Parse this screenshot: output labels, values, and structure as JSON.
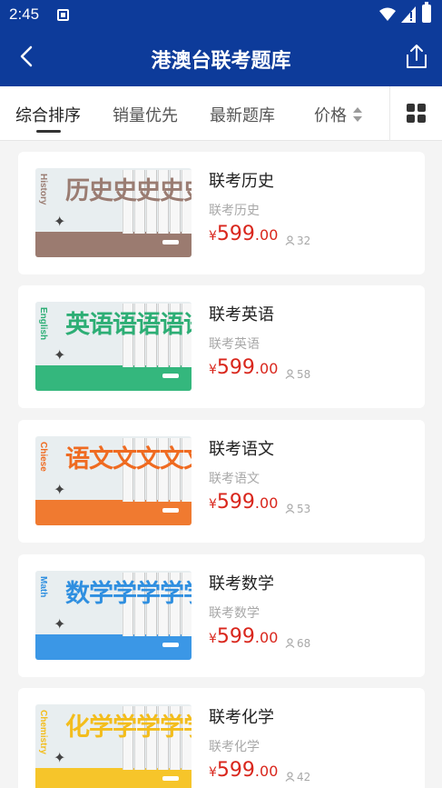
{
  "status_bar": {
    "time": "2:45"
  },
  "header": {
    "title": "港澳台联考题库"
  },
  "sort_tabs": [
    {
      "label": "综合排序",
      "active": true
    },
    {
      "label": "销量优先",
      "active": false
    },
    {
      "label": "最新题库",
      "active": false
    },
    {
      "label": "价格",
      "active": false
    }
  ],
  "products": [
    {
      "name": "联考历史",
      "subtitle": "联考历史",
      "currency": "¥",
      "price_int": "599",
      "price_dec": ".00",
      "buyers": "32",
      "cover_en": "History",
      "cover_cn": "历史",
      "cover_repeat": "史",
      "color": "#9a7c72",
      "band": "#9b7b70"
    },
    {
      "name": "联考英语",
      "subtitle": "联考英语",
      "currency": "¥",
      "price_int": "599",
      "price_dec": ".00",
      "buyers": "58",
      "cover_en": "English",
      "cover_cn": "英语",
      "cover_repeat": "语",
      "color": "#2dae75",
      "band": "#34b77d"
    },
    {
      "name": "联考语文",
      "subtitle": "联考语文",
      "currency": "¥",
      "price_int": "599",
      "price_dec": ".00",
      "buyers": "53",
      "cover_en": "Chiese",
      "cover_cn": "语文",
      "cover_repeat": "文",
      "color": "#ef6b21",
      "band": "#f07a30"
    },
    {
      "name": "联考数学",
      "subtitle": "联考数学",
      "currency": "¥",
      "price_int": "599",
      "price_dec": ".00",
      "buyers": "68",
      "cover_en": "Math",
      "cover_cn": "数学",
      "cover_repeat": "学",
      "color": "#2f8fe0",
      "band": "#3b97e6"
    },
    {
      "name": "联考化学",
      "subtitle": "联考化学",
      "currency": "¥",
      "price_int": "599",
      "price_dec": ".00",
      "buyers": "42",
      "cover_en": "Chemistry",
      "cover_cn": "化学",
      "cover_repeat": "学",
      "color": "#f3bd1c",
      "band": "#f6c52a"
    }
  ]
}
